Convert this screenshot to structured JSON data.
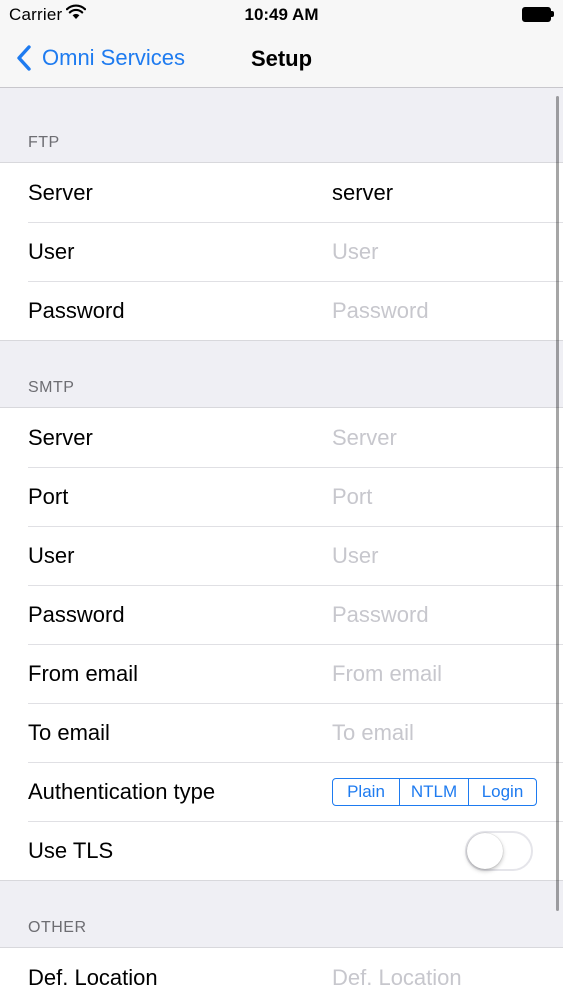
{
  "status_bar": {
    "carrier": "Carrier",
    "time": "10:49 AM"
  },
  "nav": {
    "back_label": "Omni Services",
    "title": "Setup",
    "accent_color": "#1e7bf0"
  },
  "ftp": {
    "header": "FTP",
    "server_label": "Server",
    "server_value": "server",
    "user_label": "User",
    "user_placeholder": "User",
    "password_label": "Password",
    "password_placeholder": "Password"
  },
  "smtp": {
    "header": "SMTP",
    "server_label": "Server",
    "server_placeholder": "Server",
    "port_label": "Port",
    "port_placeholder": "Port",
    "user_label": "User",
    "user_placeholder": "User",
    "password_label": "Password",
    "password_placeholder": "Password",
    "from_label": "From email",
    "from_placeholder": "From email",
    "to_label": "To email",
    "to_placeholder": "To email",
    "auth_label": "Authentication type",
    "auth_options": [
      "Plain",
      "NTLM",
      "Login"
    ],
    "tls_label": "Use TLS",
    "tls_on": false
  },
  "other": {
    "header": "OTHER",
    "location_label": "Def. Location",
    "location_placeholder": "Def. Location"
  }
}
